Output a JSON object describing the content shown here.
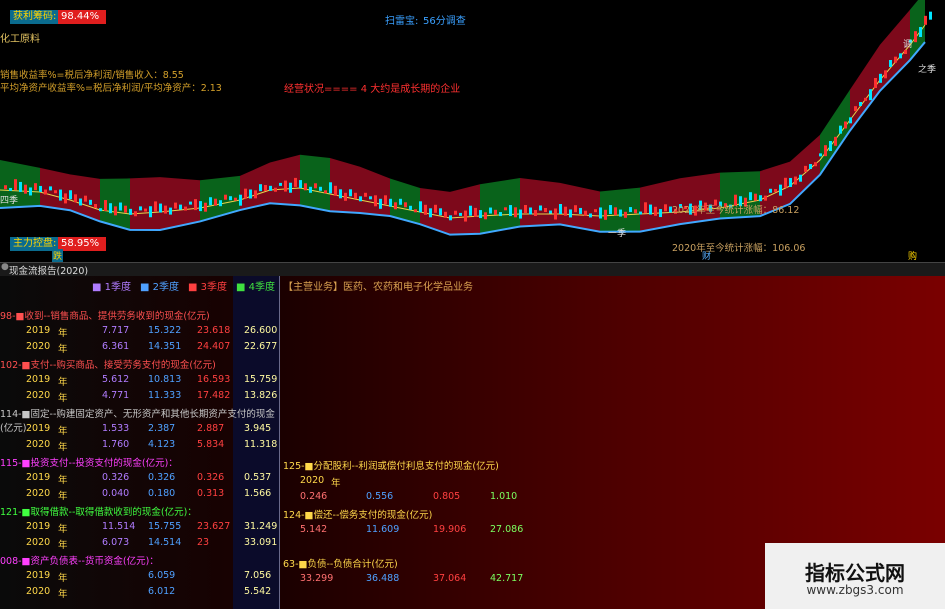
{
  "chart_header": {
    "profit_label": "获利筹码:",
    "profit_value": "98.44%",
    "stock_name": "化工原料",
    "scan_label": "扫雷宝:",
    "scan_value": "56分调查",
    "line_sales": "销售收益率%=税后净利润/销售收入：8.55",
    "line_roe": "平均净资产收益率%=税后净利润/平均净资产：2.13",
    "business_status": "经营状况==== 4 大约是成长期的企业",
    "stat_2021": "2021年至今统计涨幅：86.12",
    "stat_2020": "2020年至今统计涨幅：106.06",
    "control_label": "主力控盘:",
    "control_value": "58.95%",
    "tag_die": "跌",
    "tag_cai": "财",
    "tag_gou": "购",
    "season_labels": [
      "四季",
      "一季",
      "之季",
      "调"
    ],
    "accent_colors": {
      "up": "#ff3030",
      "down": "#00e5ff",
      "band_red": "#8b0a1e",
      "band_green": "#0a6e1e",
      "mid_line": "#e8d44a",
      "upper_line": "#40a8ff"
    }
  },
  "window": {
    "title": "现金流报告(2020)"
  },
  "table": {
    "headers": {
      "q1": "1季度",
      "q2": "2季度",
      "q3": "3季度",
      "q4": "4季度"
    },
    "main_business": "【主营业务】医药、农药和电子化学品业务",
    "sections_left": [
      {
        "title": "98-■收到--销售商品、提供劳务收到的现金(亿元)",
        "rows": [
          {
            "year": "2019",
            "unit": "年",
            "q1": "7.717",
            "q2": "15.322",
            "q3": "23.618",
            "q4": "26.600"
          },
          {
            "year": "2020",
            "unit": "年",
            "q1": "6.361",
            "q2": "14.351",
            "q3": "24.407",
            "q4": "22.677"
          }
        ]
      },
      {
        "title": "102-■支付--购买商品、接受劳务支付的现金(亿元)",
        "rows": [
          {
            "year": "2019",
            "unit": "年",
            "q1": "5.612",
            "q2": "10.813",
            "q3": "16.593",
            "q4": "15.759"
          },
          {
            "year": "2020",
            "unit": "年",
            "q1": "4.771",
            "q2": "11.333",
            "q3": "17.482",
            "q4": "13.826"
          }
        ]
      },
      {
        "title": "114-■固定--购建固定资产、无形资产和其他长期资产支付的现金(亿元)",
        "rows": [
          {
            "year": "2019",
            "unit": "年",
            "q1": "1.533",
            "q2": "2.387",
            "q3": "2.887",
            "q4": "3.945"
          },
          {
            "year": "2020",
            "unit": "年",
            "q1": "1.760",
            "q2": "4.123",
            "q3": "5.834",
            "q4": "11.318"
          }
        ]
      },
      {
        "title": "115-■投资支付--投资支付的现金(亿元)：",
        "rows": [
          {
            "year": "2019",
            "unit": "年",
            "q1": "0.326",
            "q2": "0.326",
            "q3": "0.326",
            "q4": "0.537"
          },
          {
            "year": "2020",
            "unit": "年",
            "q1": "0.040",
            "q2": "0.180",
            "q3": "0.313",
            "q4": "1.566"
          }
        ]
      },
      {
        "title": "121-■取得借款--取得借款收到的现金(亿元)：",
        "rows": [
          {
            "year": "2019",
            "unit": "年",
            "q1": "11.514",
            "q2": "15.755",
            "q3": "23.627",
            "q4": "31.249"
          },
          {
            "year": "2020",
            "unit": "年",
            "q1": "6.073",
            "q2": "14.514",
            "q3": "23",
            "q4": "33.091"
          }
        ]
      },
      {
        "title": "008-■资产负债表--货币资金(亿元)：",
        "rows": [
          {
            "year": "2019",
            "unit": "年",
            "q1": "",
            "q2": "6.059",
            "q3": "",
            "q4": "7.056"
          },
          {
            "year": "2020",
            "unit": "年",
            "q1": "",
            "q2": "6.012",
            "q3": "",
            "q4": "5.542"
          }
        ]
      }
    ],
    "sections_right": [
      {
        "title": "125-■分配股利--利润或偿付利息支付的现金(亿元)",
        "rows": [
          {
            "year": "2020",
            "unit": "年",
            "q1": "",
            "q2": "",
            "q3": "",
            "q4": ""
          },
          {
            "year": "",
            "unit": "",
            "q1": "0.246",
            "q2": "0.556",
            "q3": "0.805",
            "q4": "1.010"
          }
        ]
      },
      {
        "title": "124-■偿还--偿务支付的现金(亿元)",
        "rows": [
          {
            "year": "",
            "unit": "",
            "q1": "5.142",
            "q2": "11.609",
            "q3": "19.906",
            "q4": "27.086"
          }
        ]
      },
      {
        "title": "63-■负债--负债合计(亿元)",
        "rows": [
          {
            "year": "",
            "unit": "",
            "q1": "33.299",
            "q2": "36.488",
            "q3": "37.064",
            "q4": "42.717"
          }
        ]
      }
    ]
  },
  "watermark": {
    "title": "指标公式网",
    "url": "www.zbgs3.com"
  }
}
